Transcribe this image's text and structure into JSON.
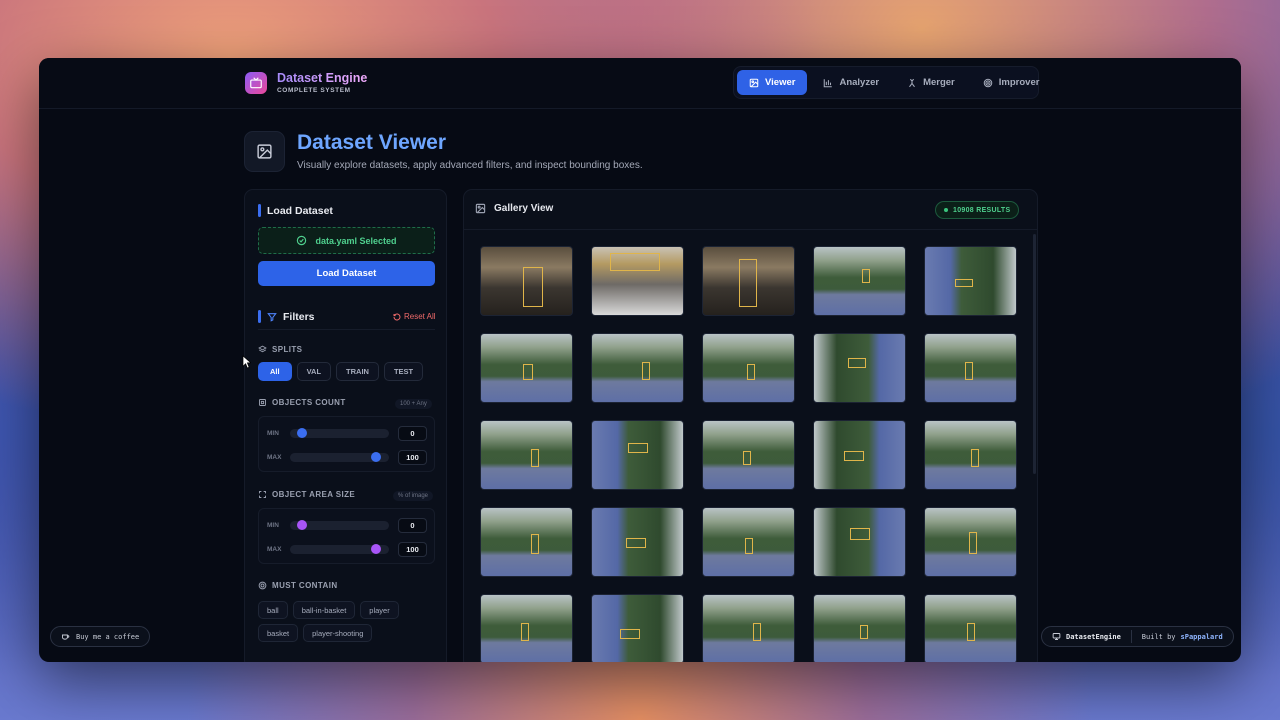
{
  "brand": {
    "title": "Dataset Engine",
    "subtitle": "COMPLETE SYSTEM"
  },
  "nav": [
    {
      "label": "Viewer",
      "icon": "image-icon",
      "active": true
    },
    {
      "label": "Analyzer",
      "icon": "bar-chart-icon",
      "active": false
    },
    {
      "label": "Merger",
      "icon": "merge-icon",
      "active": false
    },
    {
      "label": "Improver",
      "icon": "target-icon",
      "active": false
    }
  ],
  "page": {
    "title": "Dataset Viewer",
    "subtitle": "Visually explore datasets, apply advanced filters, and inspect bounding boxes."
  },
  "load": {
    "title": "Load Dataset",
    "selected_file": "data.yaml Selected",
    "button_label": "Load Dataset"
  },
  "filters": {
    "title": "Filters",
    "reset_label": "Reset All",
    "splits_label": "SPLITS",
    "splits": [
      "All",
      "VAL",
      "TRAIN",
      "TEST"
    ],
    "objects_count": {
      "label": "OBJECTS COUNT",
      "hint": "100 + Any",
      "min_label": "MIN",
      "max_label": "MAX",
      "min": "0",
      "max": "100"
    },
    "object_area": {
      "label": "OBJECT AREA SIZE",
      "hint": "% of image",
      "min_label": "MIN",
      "max_label": "MAX",
      "min": "0",
      "max": "100"
    },
    "must_contain_label": "MUST CONTAIN",
    "classes": [
      "ball",
      "ball-in-basket",
      "player",
      "basket",
      "player-shooting"
    ]
  },
  "gallery": {
    "title": "Gallery View",
    "results": "10908 RESULTS"
  },
  "footer": {
    "coffee": "Buy me a coffee",
    "app_name": "DatasetEngine",
    "built_by": "Built by",
    "author": "sPappalard"
  },
  "colors": {
    "accent": "#2d63e8",
    "success": "#4fd08e",
    "danger": "#ef6a6a",
    "violet": "#a855f7"
  }
}
